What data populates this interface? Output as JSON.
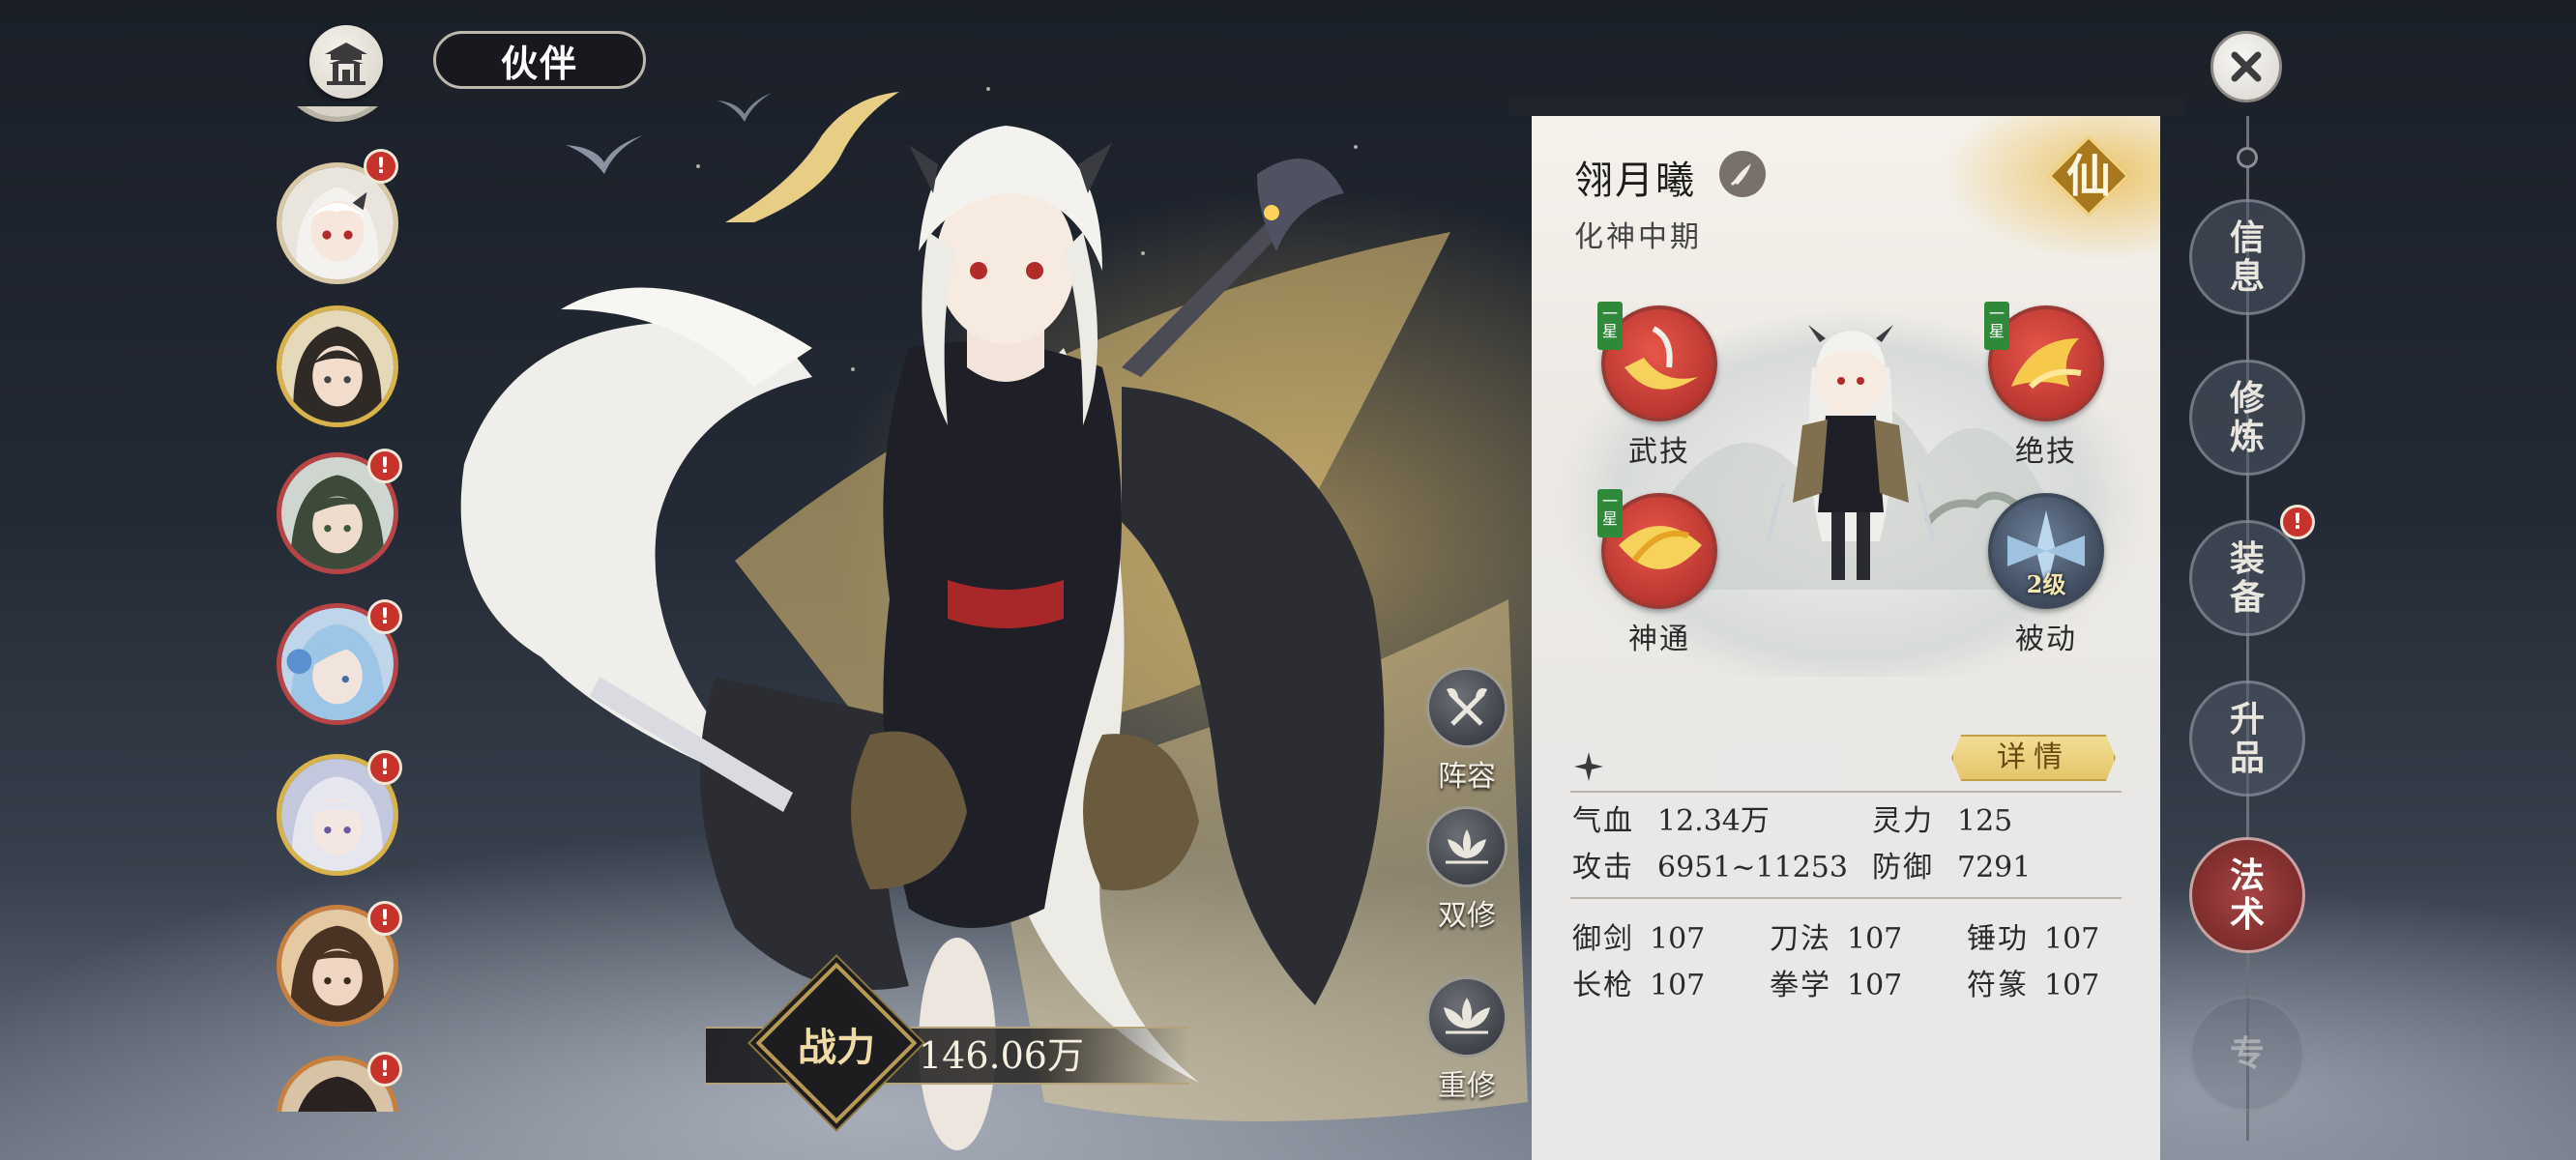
{
  "header": {
    "title": "伙伴"
  },
  "alert_glyph": "!",
  "portraits": [
    {
      "name": "portrait-selected",
      "alert": true,
      "selected": true
    },
    {
      "name": "portrait-2",
      "alert": false
    },
    {
      "name": "portrait-3",
      "alert": true
    },
    {
      "name": "portrait-4",
      "alert": true
    },
    {
      "name": "portrait-5",
      "alert": true
    },
    {
      "name": "portrait-6",
      "alert": true
    },
    {
      "name": "portrait-7",
      "alert": true
    }
  ],
  "side_actions": [
    {
      "label": "阵容",
      "icon": "crossed-axes-icon"
    },
    {
      "label": "双修",
      "icon": "lotus-icon"
    },
    {
      "label": "重修",
      "icon": "lotus-icon"
    }
  ],
  "power": {
    "label": "战力",
    "value": "146.06万"
  },
  "character": {
    "name": "翎月曦",
    "realm": "化神中期",
    "rank": "仙",
    "weapon_icon": "blade-icon"
  },
  "skills": [
    {
      "name": "武技",
      "tag": "一星"
    },
    {
      "name": "绝技",
      "tag": "一星"
    },
    {
      "name": "神通",
      "tag": "一星"
    },
    {
      "name": "被动",
      "level": "2级"
    }
  ],
  "detail_button": "详情",
  "stats": {
    "hp": {
      "label": "气血",
      "value": "12.34万"
    },
    "spirit": {
      "label": "灵力",
      "value": "125"
    },
    "attack": {
      "label": "攻击",
      "value": "6951~11253"
    },
    "defense": {
      "label": "防御",
      "value": "7291"
    }
  },
  "proficiencies": [
    {
      "label": "御剑",
      "value": "107"
    },
    {
      "label": "刀法",
      "value": "107"
    },
    {
      "label": "锤功",
      "value": "107"
    },
    {
      "label": "长枪",
      "value": "107"
    },
    {
      "label": "拳学",
      "value": "107"
    },
    {
      "label": "符篆",
      "value": "107"
    }
  ],
  "nav_tabs": [
    {
      "label": "信息",
      "active": false
    },
    {
      "label": "修炼",
      "active": false
    },
    {
      "label": "装备",
      "active": false,
      "alert": true
    },
    {
      "label": "升品",
      "active": false
    },
    {
      "label": "法术",
      "active": true
    },
    {
      "label": "专",
      "active": false
    }
  ],
  "colors": {
    "accent_red": "#b84545",
    "gold": "#d8b24a",
    "active_tab": "#a74444",
    "alert": "#c8322c"
  }
}
